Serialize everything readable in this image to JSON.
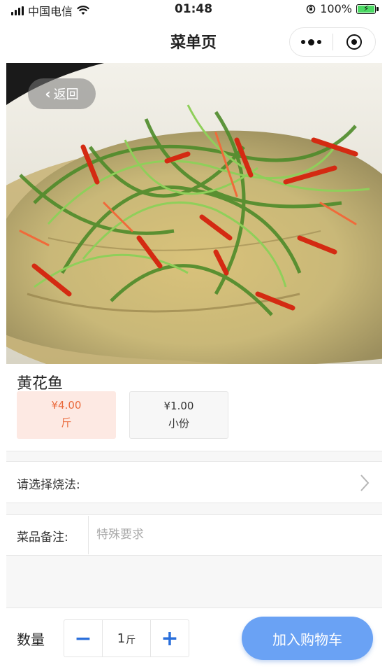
{
  "status_bar": {
    "carrier": "中国电信",
    "time": "01:48",
    "battery": "100%"
  },
  "nav": {
    "title": "菜单页"
  },
  "back": {
    "label": "返回"
  },
  "dish": {
    "name": "黄花鱼",
    "image_icon": "dish-photo",
    "specs": [
      {
        "price": "¥4.00",
        "unit": "斤",
        "selected": true
      },
      {
        "price": "¥1.00",
        "unit": "小份",
        "selected": false
      }
    ]
  },
  "cooking": {
    "label": "请选择烧法:",
    "arrow_icon": "chevron-right-icon"
  },
  "note": {
    "label": "菜品备注:",
    "placeholder": "特殊要求",
    "value": ""
  },
  "quantity": {
    "label": "数量",
    "minus": "−",
    "value": "1",
    "unit": "斤",
    "plus": "+"
  },
  "cart": {
    "label": "加入购物车"
  },
  "colors": {
    "accent": "#ea6a3c",
    "accent_bg": "#fde9e3",
    "primary": "#2a6fdb",
    "cart_button": "#6aa2f4"
  }
}
